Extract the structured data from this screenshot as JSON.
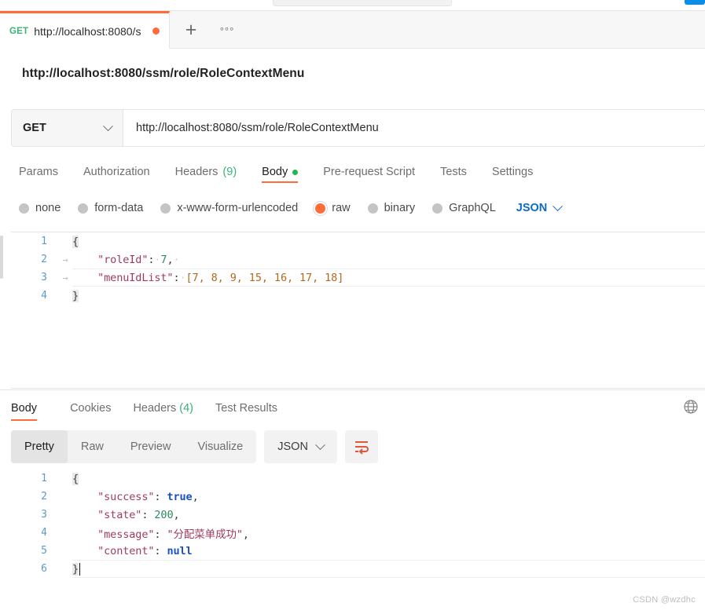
{
  "window": {
    "watermark": "CSDN @wzdhc"
  },
  "tabbar": {
    "tabs": [
      {
        "method": "GET",
        "name": "http://localhost:8080/s",
        "unsaved": true
      }
    ],
    "new_tab_label": "+",
    "more_label": "°°°"
  },
  "request": {
    "title": "http://localhost:8080/ssm/role/RoleContextMenu",
    "method": "GET",
    "url": "http://localhost:8080/ssm/role/RoleContextMenu",
    "tabs": [
      {
        "label": "Params",
        "active": false
      },
      {
        "label": "Authorization",
        "active": false
      },
      {
        "label": "Headers",
        "count": "(9)",
        "active": false
      },
      {
        "label": "Body",
        "active": true,
        "dot": true
      },
      {
        "label": "Pre-request Script",
        "active": false
      },
      {
        "label": "Tests",
        "active": false
      },
      {
        "label": "Settings",
        "active": false
      }
    ],
    "body_types": [
      {
        "label": "none",
        "selected": false
      },
      {
        "label": "form-data",
        "selected": false
      },
      {
        "label": "x-www-form-urlencoded",
        "selected": false
      },
      {
        "label": "raw",
        "selected": true
      },
      {
        "label": "binary",
        "selected": false
      },
      {
        "label": "GraphQL",
        "selected": false
      }
    ],
    "raw_format": "JSON",
    "body_lines": [
      {
        "num": "1",
        "fold": ""
      },
      {
        "num": "2",
        "fold": "→"
      },
      {
        "num": "3",
        "fold": "→"
      },
      {
        "num": "4",
        "fold": ""
      }
    ],
    "body_code": {
      "line1": "{",
      "line2_key": "\"roleId\"",
      "line2_val": "7",
      "line3_key": "\"menuIdList\"",
      "line3_val": "[7, 8, 9, 15, 16, 17, 18]",
      "line4": "}"
    }
  },
  "response": {
    "tabs": [
      {
        "label": "Body",
        "active": true
      },
      {
        "label": "Cookies",
        "active": false
      },
      {
        "label": "Headers",
        "count": "(4)",
        "active": false
      },
      {
        "label": "Test Results",
        "active": false
      }
    ],
    "view_modes": [
      {
        "label": "Pretty",
        "active": true
      },
      {
        "label": "Raw",
        "active": false
      },
      {
        "label": "Preview",
        "active": false
      },
      {
        "label": "Visualize",
        "active": false
      }
    ],
    "format": "JSON",
    "body_lines": [
      {
        "num": "1"
      },
      {
        "num": "2"
      },
      {
        "num": "3"
      },
      {
        "num": "4"
      },
      {
        "num": "5"
      },
      {
        "num": "6"
      }
    ],
    "body_code": {
      "line1": "{",
      "line2_key": "\"success\"",
      "line2_val": "true",
      "line3_key": "\"state\"",
      "line3_val": "200",
      "line4_key": "\"message\"",
      "line4_val": "\"分配菜单成功\"",
      "line5_key": "\"content\"",
      "line5_val": "null",
      "line6": "}"
    }
  },
  "icons": {
    "globe": "globe-icon",
    "wrap": "word-wrap-icon",
    "chevron": "chevron-down-icon"
  },
  "colors": {
    "accent": "#ff6c37",
    "green": "#3cb179",
    "blue": "#0b6bcb"
  }
}
